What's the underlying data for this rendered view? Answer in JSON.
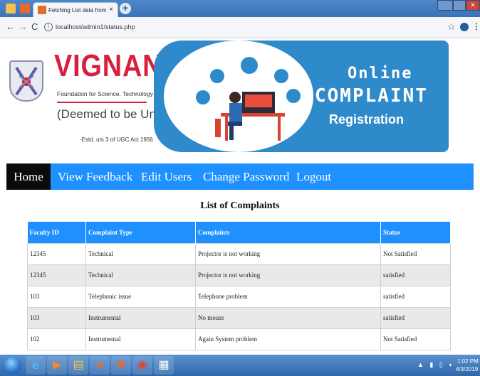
{
  "browser": {
    "tab_title": "Fetching List data from database",
    "tab_close": "×",
    "new_tab": "+",
    "url": "localhost/admin1/status.php",
    "info_icon": "i",
    "back": "←",
    "forward": "→",
    "reload": "C",
    "bookmark": "☆",
    "menu": "⋮",
    "close_glyph": "✕"
  },
  "header": {
    "brand_name": "VIGNAN'S",
    "brand_line1": "Foundation for Science, Technology & Research",
    "brand_line2": "(Deemed to be University)",
    "brand_line3": "-Estd. u/s 3 of UGC Act 1956",
    "banner_line1": "Online",
    "banner_line2": "COMPLAINT",
    "banner_line3": "Registration"
  },
  "nav": {
    "items": [
      {
        "label": "Home",
        "active": true
      },
      {
        "label": "View Feedback",
        "active": false
      },
      {
        "label": "Edit Users",
        "active": false
      },
      {
        "label": "Change Password",
        "active": false
      },
      {
        "label": "Logout",
        "active": false
      }
    ]
  },
  "page_title": "List of Complaints",
  "table": {
    "headers": [
      "Faculty ID",
      "Complaint Type",
      "Complaints",
      "Status"
    ],
    "rows": [
      [
        "12345",
        "Technical",
        "Projector is not working",
        "Not Satisfied"
      ],
      [
        "12345",
        "Technical",
        "Projector is not working",
        "satisfied"
      ],
      [
        "103",
        "Telephonic issue",
        "Telephone problem",
        "satisfied"
      ],
      [
        "103",
        "Instrumental",
        "No mouse",
        "satisfied"
      ],
      [
        "102",
        "Instrumental",
        "Again System problem",
        "Not Satisfied"
      ]
    ]
  },
  "taskbar": {
    "time": "1:02 PM",
    "date": "4/3/2019",
    "tray_icons": "▲ ▮ ▯ ◐"
  },
  "colors": {
    "accent": "#1e90ff",
    "brand_red": "#d81f3c",
    "banner_blue": "#2f8acb",
    "active_nav": "#0b0b0b"
  }
}
